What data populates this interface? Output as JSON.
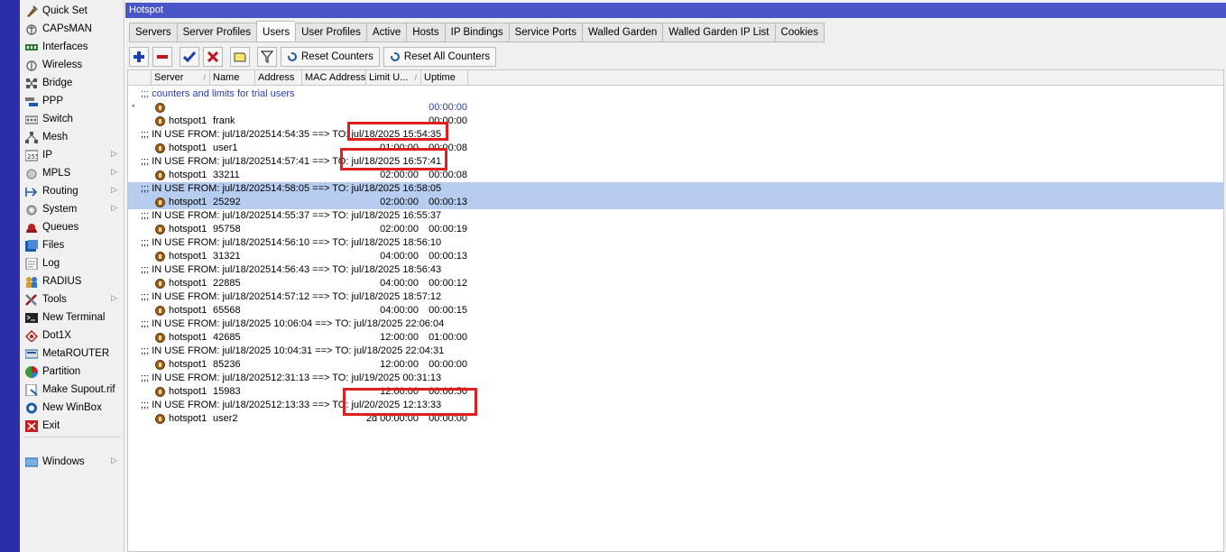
{
  "menu": [
    {
      "label": "Quick Set",
      "icon": "quick-set-icon",
      "arrow": false
    },
    {
      "label": "CAPsMAN",
      "icon": "capsman-icon",
      "arrow": false
    },
    {
      "label": "Interfaces",
      "icon": "interfaces-icon",
      "arrow": false
    },
    {
      "label": "Wireless",
      "icon": "wireless-icon",
      "arrow": false
    },
    {
      "label": "Bridge",
      "icon": "bridge-icon",
      "arrow": false
    },
    {
      "label": "PPP",
      "icon": "ppp-icon",
      "arrow": false
    },
    {
      "label": "Switch",
      "icon": "switch-icon",
      "arrow": false
    },
    {
      "label": "Mesh",
      "icon": "mesh-icon",
      "arrow": false
    },
    {
      "label": "IP",
      "icon": "ip-icon",
      "arrow": true
    },
    {
      "label": "MPLS",
      "icon": "mpls-icon",
      "arrow": true
    },
    {
      "label": "Routing",
      "icon": "routing-icon",
      "arrow": true
    },
    {
      "label": "System",
      "icon": "system-icon",
      "arrow": true
    },
    {
      "label": "Queues",
      "icon": "queues-icon",
      "arrow": false
    },
    {
      "label": "Files",
      "icon": "files-icon",
      "arrow": false
    },
    {
      "label": "Log",
      "icon": "log-icon",
      "arrow": false
    },
    {
      "label": "RADIUS",
      "icon": "radius-icon",
      "arrow": false
    },
    {
      "label": "Tools",
      "icon": "tools-icon",
      "arrow": true
    },
    {
      "label": "New Terminal",
      "icon": "terminal-icon",
      "arrow": false
    },
    {
      "label": "Dot1X",
      "icon": "dot1x-icon",
      "arrow": false
    },
    {
      "label": "MetaROUTER",
      "icon": "metarouter-icon",
      "arrow": false
    },
    {
      "label": "Partition",
      "icon": "partition-icon",
      "arrow": false
    },
    {
      "label": "Make Supout.rif",
      "icon": "supout-icon",
      "arrow": false
    },
    {
      "label": "New WinBox",
      "icon": "winbox-icon",
      "arrow": false
    },
    {
      "label": "Exit",
      "icon": "exit-icon",
      "arrow": false
    }
  ],
  "windows_item": {
    "label": "Windows"
  },
  "window": {
    "title": "Hotspot"
  },
  "tabs": [
    "Servers",
    "Server Profiles",
    "Users",
    "User Profiles",
    "Active",
    "Hosts",
    "IP Bindings",
    "Service Ports",
    "Walled Garden",
    "Walled Garden IP List",
    "Cookies"
  ],
  "active_tab": "Users",
  "toolbar": {
    "reset_counters": "Reset Counters",
    "reset_all_counters": "Reset All Counters"
  },
  "columns": [
    "Server",
    "Name",
    "Address",
    "MAC Address",
    "Limit U...",
    "Uptime"
  ],
  "rows": [
    {
      "kind": "comment",
      "text": ";;; counters and limits for trial users",
      "blue": true
    },
    {
      "kind": "user",
      "server": "",
      "name": "",
      "limit": "",
      "uptime": "00:00:00",
      "blue": true,
      "bullet": "*"
    },
    {
      "kind": "user",
      "server": "hotspot1",
      "name": "frank",
      "limit": "",
      "uptime": "00:00:00"
    },
    {
      "kind": "comment",
      "text": ";;; IN USE FROM: jul/18/202514:54:35 ==> TO: jul/18/2025 15:54:35"
    },
    {
      "kind": "user",
      "server": "hotspot1",
      "name": "user1",
      "limit": "01:00:00",
      "uptime": "00:00:08"
    },
    {
      "kind": "comment",
      "text": ";;; IN USE FROM: jul/18/202514:57:41 ==> TO: jul/18/2025 16:57:41"
    },
    {
      "kind": "user",
      "server": "hotspot1",
      "name": "33211",
      "limit": "02:00:00",
      "uptime": "00:00:08"
    },
    {
      "kind": "comment",
      "text": ";;; IN USE FROM: jul/18/202514:58:05 ==> TO: jul/18/2025 16:58:05",
      "selected": true
    },
    {
      "kind": "user",
      "server": "hotspot1",
      "name": "25292",
      "limit": "02:00:00",
      "uptime": "00:00:13",
      "selected": true
    },
    {
      "kind": "comment",
      "text": ";;; IN USE FROM: jul/18/202514:55:37 ==> TO: jul/18/2025 16:55:37"
    },
    {
      "kind": "user",
      "server": "hotspot1",
      "name": "95758",
      "limit": "02:00:00",
      "uptime": "00:00:19"
    },
    {
      "kind": "comment",
      "text": ";;; IN USE FROM: jul/18/202514:56:10 ==> TO: jul/18/2025 18:56:10"
    },
    {
      "kind": "user",
      "server": "hotspot1",
      "name": "31321",
      "limit": "04:00:00",
      "uptime": "00:00:13"
    },
    {
      "kind": "comment",
      "text": ";;; IN USE FROM: jul/18/202514:56:43 ==> TO: jul/18/2025 18:56:43"
    },
    {
      "kind": "user",
      "server": "hotspot1",
      "name": "22885",
      "limit": "04:00:00",
      "uptime": "00:00:12"
    },
    {
      "kind": "comment",
      "text": ";;; IN USE FROM: jul/18/202514:57:12 ==> TO: jul/18/2025 18:57:12"
    },
    {
      "kind": "user",
      "server": "hotspot1",
      "name": "65568",
      "limit": "04:00:00",
      "uptime": "00:00:15"
    },
    {
      "kind": "comment",
      "text": ";;; IN USE FROM: jul/18/2025 10:06:04 ==> TO: jul/18/2025 22:06:04"
    },
    {
      "kind": "user",
      "server": "hotspot1",
      "name": "42685",
      "limit": "12:00:00",
      "uptime": "01:00:00"
    },
    {
      "kind": "comment",
      "text": ";;; IN USE FROM: jul/18/2025 10:04:31 ==> TO: jul/18/2025 22:04:31"
    },
    {
      "kind": "user",
      "server": "hotspot1",
      "name": "85236",
      "limit": "12:00:00",
      "uptime": "00:00:00"
    },
    {
      "kind": "comment",
      "text": ";;; IN USE FROM: jul/18/202512:31:13 ==> TO: jul/19/2025 00:31:13"
    },
    {
      "kind": "user",
      "server": "hotspot1",
      "name": "15983",
      "limit": "12:00:00",
      "uptime": "00:00:50"
    },
    {
      "kind": "comment",
      "text": ";;; IN USE FROM: jul/18/202512:13:33 ==> TO: jul/20/2025 12:13:33"
    },
    {
      "kind": "user",
      "server": "hotspot1",
      "name": "user2",
      "limit": "2d 00:00:00",
      "uptime": "00:00:00"
    }
  ],
  "colors": {
    "highlight": "#e01e1e",
    "selection": "#b7cdf0",
    "title_bar": "#4a56c8",
    "left_bar": "#2b2ea8"
  }
}
